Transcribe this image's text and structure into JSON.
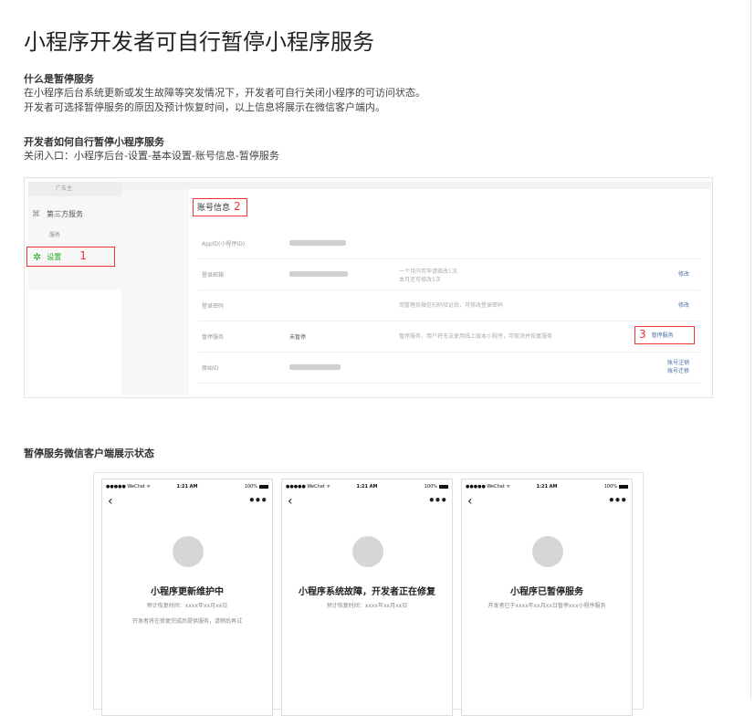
{
  "title": "小程序开发者可自行暂停小程序服务",
  "section1": {
    "heading": "什么是暂停服务",
    "lines": [
      "在小程序后台系统更新或发生故障等突发情况下，开发者可自行关闭小程序的可访问状态。",
      "开发者可选择暂停服务的原因及预计恢复时间，以上信息将展示在微信客户端内。"
    ]
  },
  "section2": {
    "heading": "开发者如何自行暂停小程序服务",
    "line": "关闭入口：小程序后台-设置-基本设置-账号信息-暂停服务"
  },
  "admin": {
    "side_top": "广告主",
    "third_party": "第三方服务",
    "service": "服务",
    "settings": "设置",
    "step1": "1",
    "account_info": "账号信息",
    "step2": "2",
    "step3": "3",
    "rows": [
      {
        "label": "AppID(小程序ID)",
        "value": "",
        "desc": "",
        "action": ""
      },
      {
        "label": "登录邮箱",
        "value": "",
        "desc": "一个月内可申请修改1次\n本月还可修改1次",
        "action": "修改"
      },
      {
        "label": "登录密码",
        "value": "",
        "desc": "用管理员微信扫码验证后，可修改登录密码",
        "action": "修改"
      },
      {
        "label": "暂停服务",
        "value": "未暂停",
        "desc": "暂停服务，用户将无法使用线上版本小程序，可取消并恢复服务",
        "action": "暂停服务"
      },
      {
        "label": "原始ID",
        "value": "",
        "desc": "",
        "action": "账号注销\n账号迁移"
      }
    ]
  },
  "section3": {
    "heading": "暂停服务微信客户端展示状态"
  },
  "phones": [
    {
      "carrier": "●●●●● WeChat ᯤ",
      "time": "1:21 AM",
      "battery": "100%",
      "title": "小程序更新维护中",
      "sub1": "预计恢复时间：xxxx年xx月xx日",
      "sub2": "开发者将在修复完成后提供服务，请稍后再试"
    },
    {
      "carrier": "●●●●● WeChat ᯤ",
      "time": "1:21 AM",
      "battery": "100%",
      "title": "小程序系统故障，开发者正在修复",
      "sub1": "预计恢复时间：xxxx年xx月xx日",
      "sub2": ""
    },
    {
      "carrier": "●●●●● WeChat ᯤ",
      "time": "1:21 AM",
      "battery": "100%",
      "title": "小程序已暂停服务",
      "sub1": "开发者已于xxxx年xx月xx日暂停xxx小程序服务",
      "sub2": ""
    }
  ]
}
